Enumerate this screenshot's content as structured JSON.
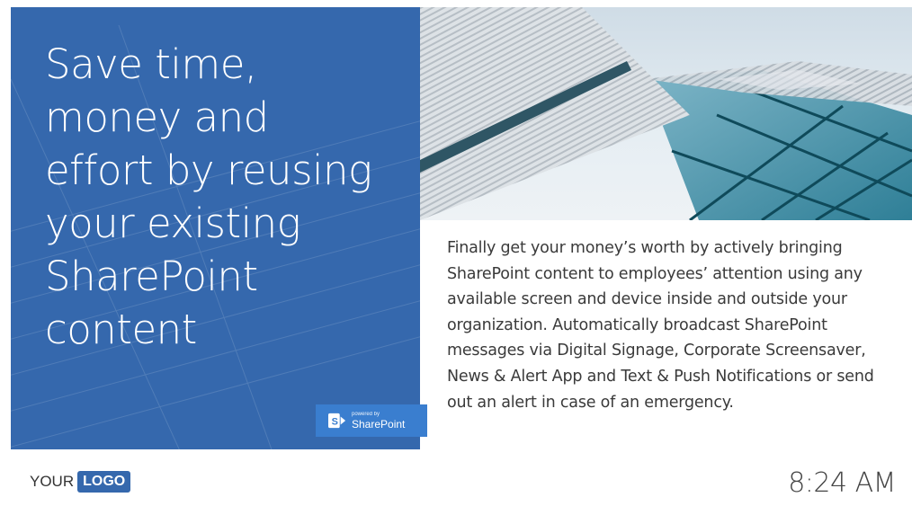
{
  "headline": "Save time,\nmoney and\neffort by reusing\nyour  existing\nSharePoint\ncontent",
  "body": "Finally get your money’s worth by actively bringing SharePoint content to employees’ attention using any available screen and device inside and outside your organization. Automatically broadcast SharePoint messages via Digital Signage, Corporate Screensaver, News & Alert App and Text & Push Notifications or send out an alert in case of an emergency.",
  "badge": {
    "small_text": "powered by",
    "label": "SharePoint"
  },
  "footer": {
    "logo_prefix": "YOUR",
    "logo_box": "LOGO",
    "time": "8:24 AM"
  },
  "colors": {
    "panel_blue": "#3568ad",
    "badge_blue": "#3a7ecf"
  },
  "icons": {
    "sharepoint": "sharepoint-icon"
  }
}
